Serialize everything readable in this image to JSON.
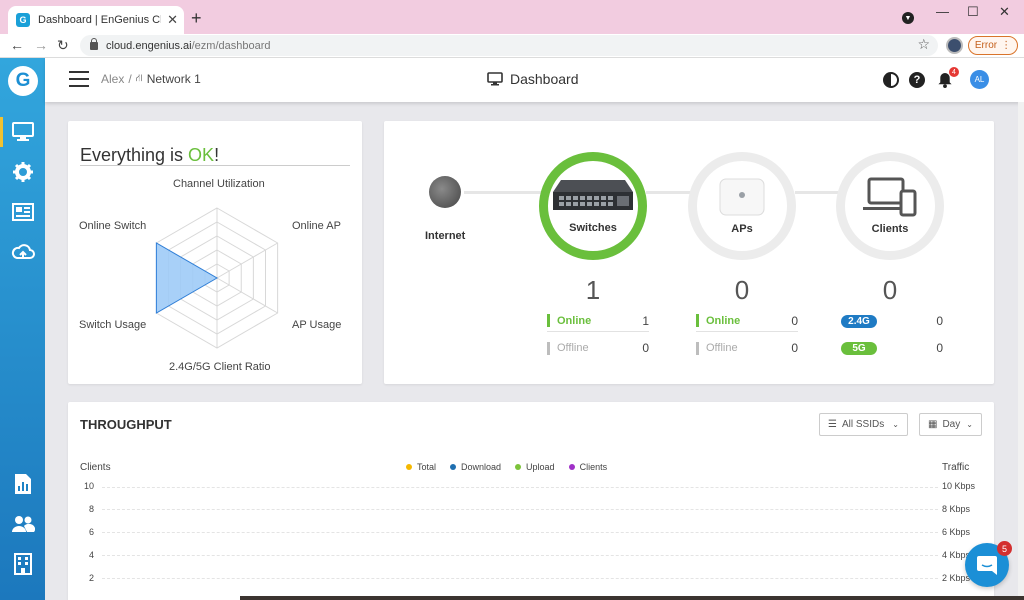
{
  "browser": {
    "tab_title": "Dashboard | EnGenius Cloud - AI",
    "url_host": "cloud.engenius.ai",
    "url_path": "/ezm/dashboard",
    "error_label": "Error"
  },
  "header": {
    "breadcrumb_user": "Alex",
    "breadcrumb_sep": "/",
    "breadcrumb_network": "Network 1",
    "title": "Dashboard",
    "notification_count": "4",
    "avatar_initials": "AL"
  },
  "status": {
    "prefix": "Everything is ",
    "ok": "OK",
    "suffix": "!",
    "radar_labels": [
      "Channel Utilization",
      "Online AP",
      "AP Usage",
      "2.4G/5G Client Ratio",
      "Switch Usage",
      "Online Switch"
    ],
    "radar_values": [
      0,
      0,
      0,
      0,
      1,
      1
    ]
  },
  "topology": {
    "internet_label": "Internet",
    "switches": {
      "label": "Switches",
      "count": "1",
      "online_label": "Online",
      "online": "1",
      "offline_label": "Offline",
      "offline": "0"
    },
    "aps": {
      "label": "APs",
      "count": "0",
      "online_label": "Online",
      "online": "0",
      "offline_label": "Offline",
      "offline": "0"
    },
    "clients": {
      "label": "Clients",
      "count": "0",
      "band1_label": "2.4G",
      "band1": "0",
      "band2_label": "5G",
      "band2": "0"
    }
  },
  "throughput": {
    "title": "THROUGHPUT",
    "ssid_select": "All SSIDs",
    "range_select": "Day",
    "left_axis_title": "Clients",
    "right_axis_title": "Traffic",
    "legend": [
      {
        "name": "Total",
        "color": "#f5b800"
      },
      {
        "name": "Download",
        "color": "#1f6fb0"
      },
      {
        "name": "Upload",
        "color": "#7cc33a"
      },
      {
        "name": "Clients",
        "color": "#a030c8"
      }
    ],
    "left_ticks": [
      "10",
      "8",
      "6",
      "4",
      "2"
    ],
    "right_ticks": [
      "10 Kbps",
      "8 Kbps",
      "6 Kbps",
      "4 Kbps",
      "2 Kbps"
    ]
  },
  "chat": {
    "badge": "5"
  },
  "colors": {
    "accent": "#1c8fd3",
    "ok_green": "#6abf3c",
    "band_24": "#1f7bc4",
    "band_5": "#6abf3c",
    "radar_fill": "#9ecbf7",
    "radar_stroke": "#2f7fd8"
  },
  "chart_data": {
    "type": "line",
    "title": "THROUGHPUT",
    "ylabel": "Clients",
    "y2label": "Traffic",
    "ylim": [
      0,
      10
    ],
    "y2lim": [
      0,
      10
    ],
    "y2unit": "Kbps",
    "series": [
      {
        "name": "Total",
        "values": []
      },
      {
        "name": "Download",
        "values": []
      },
      {
        "name": "Upload",
        "values": []
      },
      {
        "name": "Clients",
        "values": []
      }
    ],
    "grid": true,
    "legend": "top-center"
  }
}
